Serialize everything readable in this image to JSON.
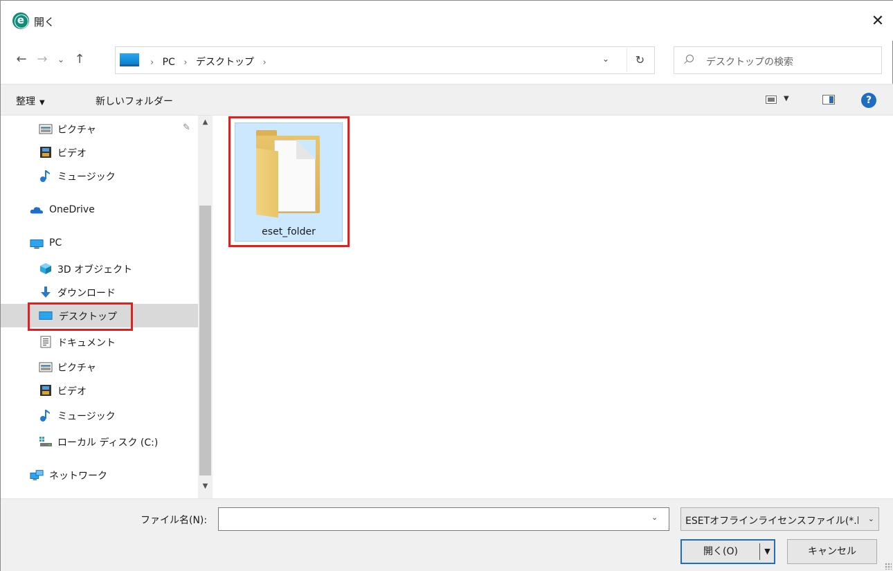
{
  "window": {
    "title": "開く",
    "app_icon_letter": "e",
    "close_glyph": "✕"
  },
  "navigation": {
    "back": "←",
    "forward": "→",
    "recent": "⌄",
    "up": "↑"
  },
  "address": {
    "crumbs": [
      "PC",
      "デスクトップ"
    ],
    "separator": "›",
    "dropdown": "⌄",
    "refresh": "↻"
  },
  "search": {
    "placeholder": "デスクトップの検索"
  },
  "toolbar": {
    "organize": "整理",
    "organize_caret": "▼",
    "new_folder": "新しいフォルダー",
    "view_caret": "▼",
    "help": "?"
  },
  "nav_pane": {
    "items": [
      {
        "label": "ピクチャ",
        "icon": "pictures-icon",
        "pinned": true
      },
      {
        "label": "ビデオ",
        "icon": "videos-icon"
      },
      {
        "label": "ミュージック",
        "icon": "music-icon"
      },
      {
        "label": "OneDrive",
        "icon": "onedrive-icon"
      },
      {
        "label": "PC",
        "icon": "pc-icon"
      },
      {
        "label": "3D オブジェクト",
        "icon": "3d-objects-icon"
      },
      {
        "label": "ダウンロード",
        "icon": "download-icon"
      },
      {
        "label": "デスクトップ",
        "icon": "desktop-icon",
        "selected": true
      },
      {
        "label": "ドキュメント",
        "icon": "documents-icon"
      },
      {
        "label": "ピクチャ",
        "icon": "pictures-icon"
      },
      {
        "label": "ビデオ",
        "icon": "videos-icon"
      },
      {
        "label": "ミュージック",
        "icon": "music-icon"
      },
      {
        "label": "ローカル ディスク (C:)",
        "icon": "local-disk-icon"
      },
      {
        "label": "ネットワーク",
        "icon": "network-icon"
      }
    ],
    "pin_glyph": "📌"
  },
  "content": {
    "items": [
      {
        "name": "eset_folder",
        "type": "folder"
      }
    ]
  },
  "footer": {
    "filename_label": "ファイル名(N):",
    "filename_value": "",
    "filetype": "ESETオフラインライセンスファイル(*.lf",
    "caret": "⌄",
    "open": "開く(O)",
    "open_dd": "▼",
    "cancel": "キャンセル"
  },
  "colors": {
    "selection": "#cce8ff",
    "highlight_annotation": "#e02020",
    "accent": "#1f6dc2"
  }
}
